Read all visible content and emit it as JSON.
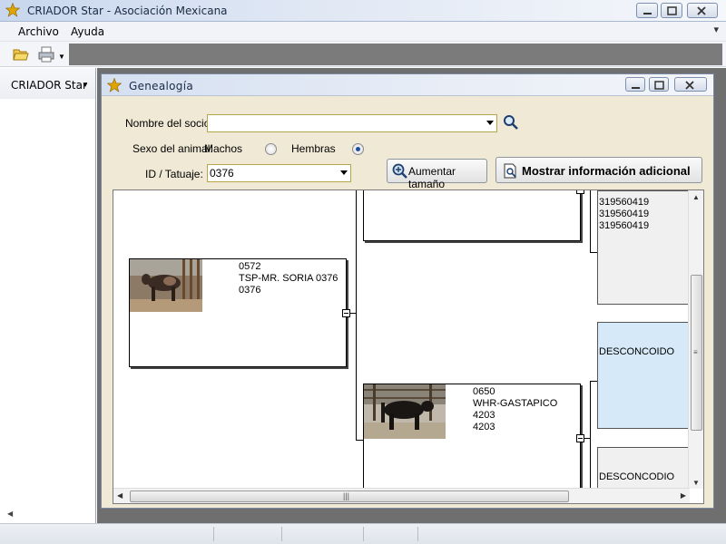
{
  "app": {
    "title": "CRIADOR Star - Asociación Mexicana",
    "menu": [
      "Archivo",
      "Ayuda"
    ],
    "left_panel_title": "CRIADOR Star"
  },
  "child": {
    "title": "Genealogía",
    "fields": {
      "socio_label": "Nombre del socio:",
      "socio_value": "",
      "sexo_label": "Sexo del animal:",
      "machos_label": "Machos",
      "hembras_label": "Hembras",
      "selected_sex": "Hembras",
      "id_label": "ID / Tatuaje:",
      "id_value": "0376"
    },
    "buttons": {
      "enlarge": "Aumentar tamaño",
      "more_info": "Mostrar información adicional"
    }
  },
  "tree": {
    "animal": {
      "id": "0572",
      "name": "TSP-MR. SORIA 0376",
      "tattoo": "0376"
    },
    "sire": {
      "id": "0650",
      "name": "WHR-GASTAPICO 4203",
      "tattoo": "4203"
    },
    "top_right_box": {
      "lines": [
        "319560419",
        "319560419",
        "319560419"
      ]
    },
    "unknown_1": "DESCONCOIDO",
    "unknown_2": "DESCONCODIO"
  },
  "colors": {
    "form_bg": "#efe9d5",
    "workspace_bg": "#6f6f6f",
    "selected_box_bg": "#d5e9f8",
    "accent_star": "#e0a400"
  }
}
